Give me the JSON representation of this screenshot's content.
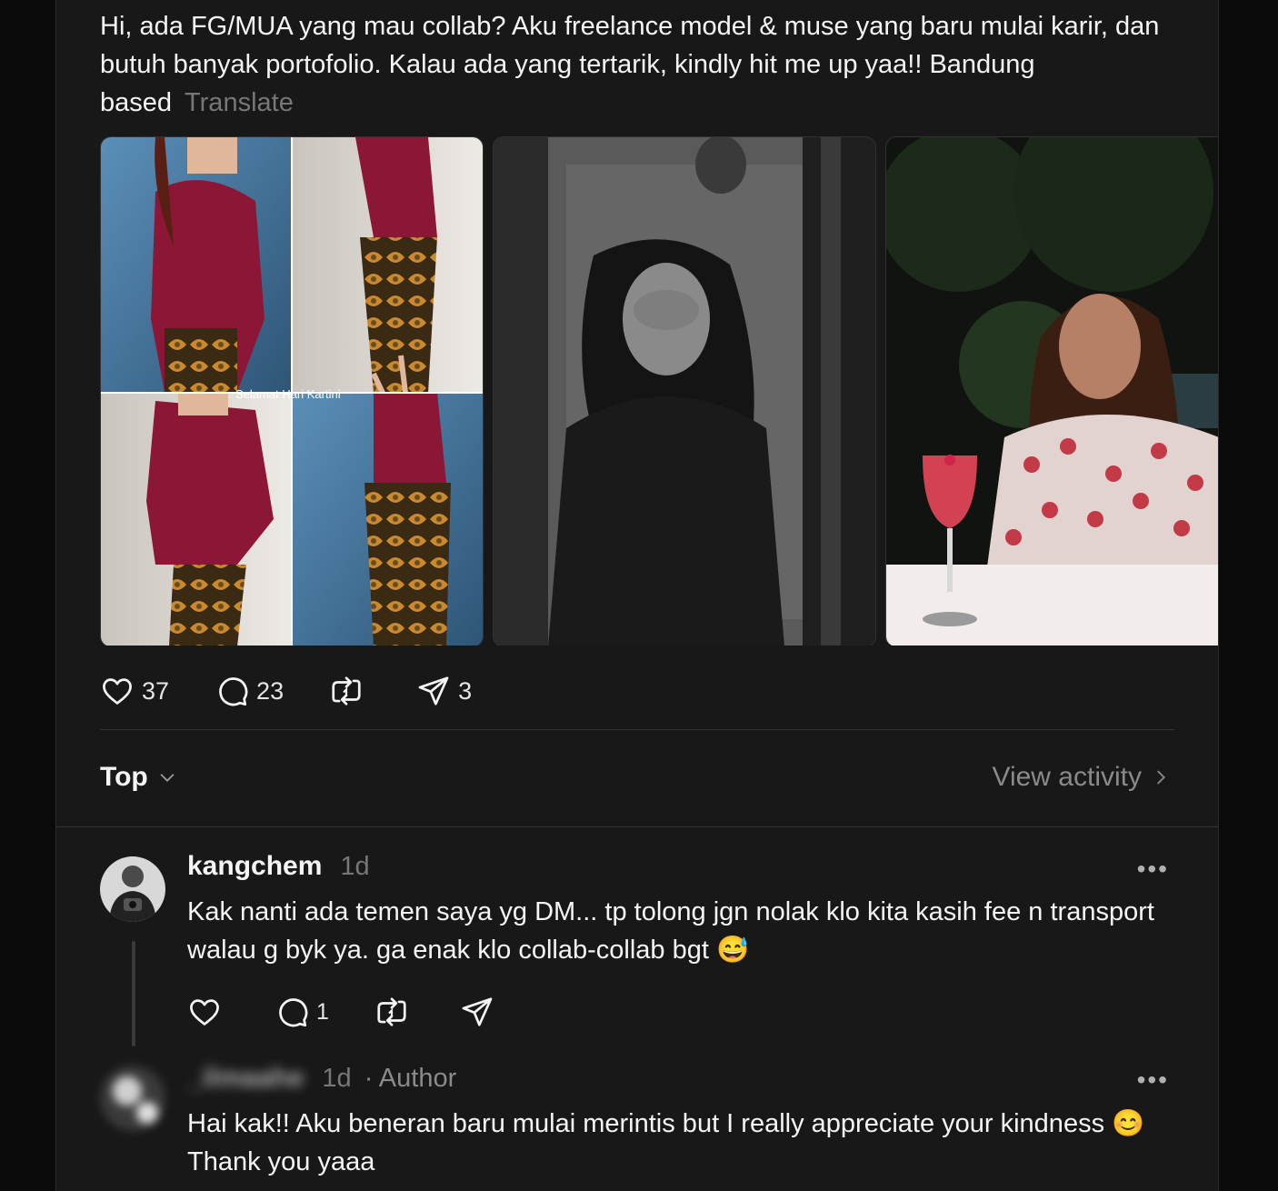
{
  "post": {
    "text": "Hi, ada FG/MUA yang mau collab? Aku freelance model & muse yang baru mulai karir, dan butuh banyak portofolio. Kalau ada yang tertarik, kindly hit me up yaa!! Bandung based",
    "translate_label": "Translate",
    "photo_caption": "Selamat Hari Kartini",
    "like_count": "37",
    "reply_count": "23",
    "share_count": "3"
  },
  "sort": {
    "label": "Top",
    "view_activity_label": "View activity"
  },
  "comments": [
    {
      "username": "kangchem",
      "time": "1d",
      "text": "Kak nanti ada temen saya yg DM... tp tolong jgn nolak klo kita kasih fee n transport walau g byk ya. ga enak klo collab-collab bgt 😅",
      "reply_count": "1"
    },
    {
      "username": "_ilmaahe",
      "time": "1d",
      "author_label": "· Author",
      "text": "Hai kak!! Aku beneran baru mulai merintis but I really appreciate your kindness 😊 Thank you yaaa"
    }
  ],
  "icons": {
    "like": "heart-icon",
    "reply": "comment-bubble-icon",
    "repost": "repost-icon",
    "share": "send-icon",
    "more": "more-dots-icon",
    "chevron": "chevron-down-icon",
    "arrow": "chevron-right-icon"
  },
  "colors": {
    "background": "#181818",
    "text": "#f3f5f7",
    "muted": "#777777"
  }
}
